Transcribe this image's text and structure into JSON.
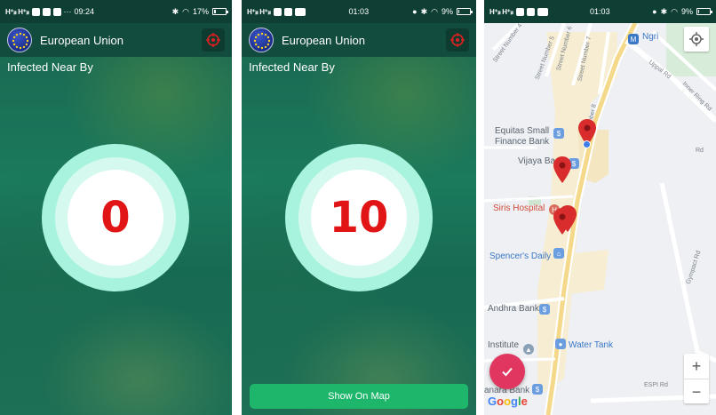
{
  "screens": [
    {
      "status": {
        "signal": "H⁺ᵢₗₗ H⁺ᵢₗₗ",
        "time": "09:24",
        "battery": "17%",
        "battery_level": 0.17
      },
      "app_title": "European Union",
      "section_label": "Infected Near By",
      "count": "0"
    },
    {
      "status": {
        "signal": "H⁺ᵢₗₗ H⁺ᵢₗₗ",
        "time": "01:03",
        "battery": "9%",
        "battery_level": 0.09
      },
      "app_title": "European Union",
      "section_label": "Infected Near By",
      "count": "10",
      "show_map_label": "Show On Map"
    },
    {
      "status": {
        "signal": "H⁺ᵢₗₗ H⁺ᵢₗₗ",
        "time": "01:03",
        "battery": "9%",
        "battery_level": 0.09
      },
      "map": {
        "places": {
          "ngri": "Ngri",
          "equitas_1": "Equitas Small",
          "equitas_2": "Finance Bank",
          "vijaya": "Vijaya Ba",
          "siris": "Siris Hospital",
          "spencers": "Spencer's Daily",
          "andhra": "Andhra Bank",
          "water_tank": "Water Tank",
          "institute": "Institute",
          "canara": "anara Bank"
        },
        "roads": {
          "street4": "Street Number 4",
          "street5": "Street Number 5",
          "street6": "Street Number 6",
          "street7": "Street Number 7",
          "street8": "Number 8",
          "uppal": "Uppal Rd",
          "inner_ring": "Inner Ring Rd",
          "rd": "Rd",
          "gympact": "Gympact Rd",
          "espi": "ESPI Rd"
        },
        "google": [
          "G",
          "o",
          "o",
          "g",
          "l",
          "e"
        ],
        "zoom_in": "+",
        "zoom_out": "−"
      }
    }
  ],
  "colors": {
    "appbar": "#114c3e",
    "counter_outer": "#a7f3de",
    "counter_number": "#e11515",
    "button_green": "#1db66b",
    "fab_pink": "#e0365f",
    "pin_red": "#d92d2d"
  },
  "icons": [
    "eu-flag-icon",
    "crosshair-target-icon",
    "check-icon",
    "my-location-icon",
    "map-pin-icon"
  ]
}
